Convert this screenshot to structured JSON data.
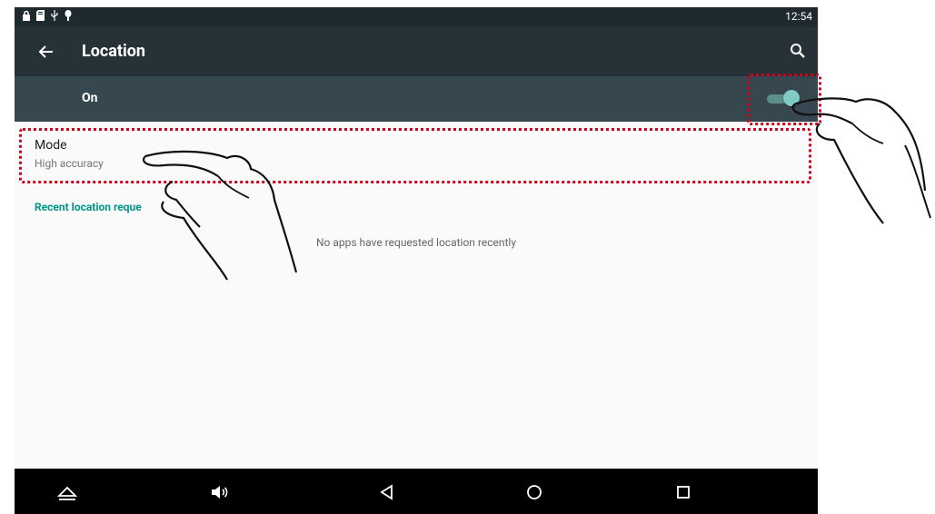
{
  "status_bar": {
    "time": "12:54",
    "icons": [
      "lock-icon",
      "sd-card-icon",
      "usb-icon",
      "notification-icon"
    ]
  },
  "app_bar": {
    "title": "Location",
    "back_icon": "back-arrow-icon",
    "search_icon": "search-icon"
  },
  "master_switch": {
    "label": "On",
    "state": "on"
  },
  "mode": {
    "title": "Mode",
    "value": "High accuracy"
  },
  "recent": {
    "header": "Recent location reque",
    "empty_message": "No apps have requested location recently"
  },
  "nav_bar": {
    "buttons": [
      "home-icon",
      "volume-icon",
      "back-icon",
      "home-circle-icon",
      "recents-icon"
    ]
  },
  "colors": {
    "appbar": "#263238",
    "switch_bar": "#37474f",
    "accent": "#009688",
    "highlight": "#d0021b"
  }
}
